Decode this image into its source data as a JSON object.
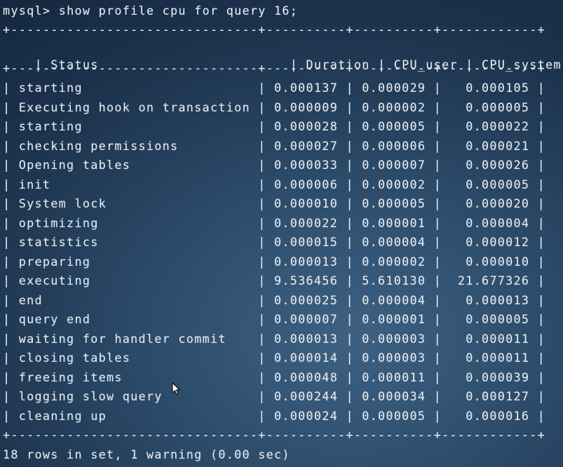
{
  "prompt": "mysql>",
  "command": "show profile cpu for query 16;",
  "columns": [
    "Status",
    "Duration",
    "CPU_user",
    "CPU_system"
  ],
  "rows": [
    [
      "starting",
      "0.000137",
      "0.000029",
      "0.000105"
    ],
    [
      "Executing hook on transaction",
      "0.000009",
      "0.000002",
      "0.000005"
    ],
    [
      "starting",
      "0.000028",
      "0.000005",
      "0.000022"
    ],
    [
      "checking permissions",
      "0.000027",
      "0.000006",
      "0.000021"
    ],
    [
      "Opening tables",
      "0.000033",
      "0.000007",
      "0.000026"
    ],
    [
      "init",
      "0.000006",
      "0.000002",
      "0.000005"
    ],
    [
      "System lock",
      "0.000010",
      "0.000005",
      "0.000020"
    ],
    [
      "optimizing",
      "0.000022",
      "0.000001",
      "0.000004"
    ],
    [
      "statistics",
      "0.000015",
      "0.000004",
      "0.000012"
    ],
    [
      "preparing",
      "0.000013",
      "0.000002",
      "0.000010"
    ],
    [
      "executing",
      "9.536456",
      "5.610130",
      "21.677326"
    ],
    [
      "end",
      "0.000025",
      "0.000004",
      "0.000013"
    ],
    [
      "query end",
      "0.000007",
      "0.000001",
      "0.000005"
    ],
    [
      "waiting for handler commit",
      "0.000013",
      "0.000003",
      "0.000011"
    ],
    [
      "closing tables",
      "0.000014",
      "0.000003",
      "0.000011"
    ],
    [
      "freeing items",
      "0.000048",
      "0.000011",
      "0.000039"
    ],
    [
      "logging slow query",
      "0.000244",
      "0.000034",
      "0.000127"
    ],
    [
      "cleaning up",
      "0.000024",
      "0.000005",
      "0.000016"
    ]
  ],
  "footer": "18 rows in set, 1 warning (0.00 sec)",
  "colors": {
    "text": "#e6ebf1",
    "background_center": "#3e6182",
    "background_edge": "#10213a"
  }
}
